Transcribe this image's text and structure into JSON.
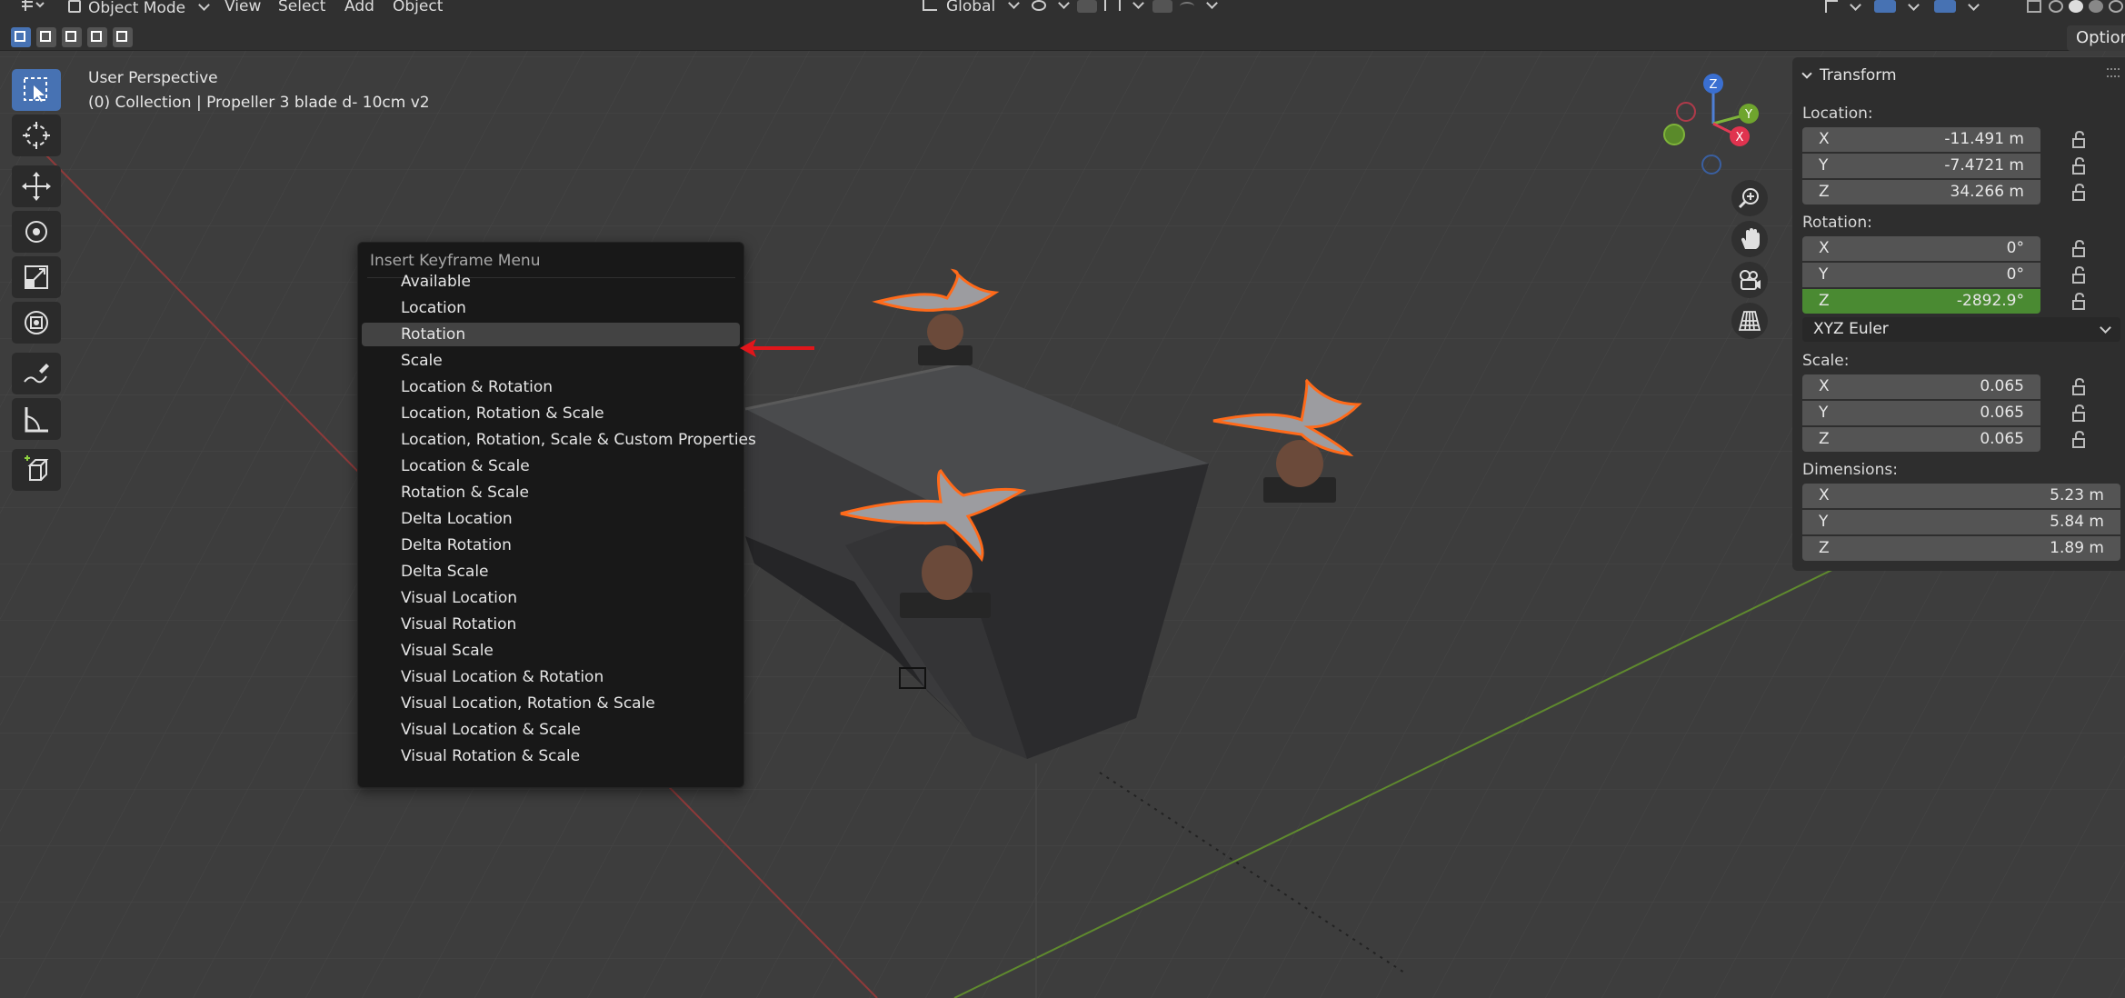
{
  "header": {
    "mode": "Object Mode",
    "menus": [
      "View",
      "Select",
      "Add",
      "Object"
    ],
    "transform_orientation": "Global"
  },
  "toolrow": {
    "options_label": "Options"
  },
  "viewport": {
    "perspective": "User Perspective",
    "collection": "(0) Collection | Propeller 3 blade d- 10cm v2"
  },
  "gizmo": {
    "x": "X",
    "y": "Y",
    "z": "Z"
  },
  "npanel": {
    "title": "Transform",
    "location_label": "Location:",
    "location": [
      {
        "axis": "X",
        "value": "-11.491 m"
      },
      {
        "axis": "Y",
        "value": "-7.4721 m"
      },
      {
        "axis": "Z",
        "value": "34.266 m"
      }
    ],
    "rotation_label": "Rotation:",
    "rotation": [
      {
        "axis": "X",
        "value": "0°"
      },
      {
        "axis": "Y",
        "value": "0°"
      },
      {
        "axis": "Z",
        "value": "-2892.9°"
      }
    ],
    "rotation_mode": "XYZ Euler",
    "scale_label": "Scale:",
    "scale": [
      {
        "axis": "X",
        "value": "0.065"
      },
      {
        "axis": "Y",
        "value": "0.065"
      },
      {
        "axis": "Z",
        "value": "0.065"
      }
    ],
    "dimensions_label": "Dimensions:",
    "dimensions": [
      {
        "axis": "X",
        "value": "5.23 m"
      },
      {
        "axis": "Y",
        "value": "5.84 m"
      },
      {
        "axis": "Z",
        "value": "1.89 m"
      }
    ]
  },
  "keyframe_menu": {
    "title": "Insert Keyframe Menu",
    "highlighted_index": 2,
    "items": [
      "Available",
      "Location",
      "Rotation",
      "Scale",
      "Location & Rotation",
      "Location, Rotation & Scale",
      "Location, Rotation, Scale & Custom Properties",
      "Location & Scale",
      "Rotation & Scale",
      "Delta Location",
      "Delta Rotation",
      "Delta Scale",
      "Visual Location",
      "Visual Rotation",
      "Visual Scale",
      "Visual Location & Rotation",
      "Visual Location, Rotation & Scale",
      "Visual Location & Scale",
      "Visual Rotation & Scale"
    ]
  },
  "colors": {
    "active_tool": "#4772b3",
    "animated_field": "#4a8a32",
    "annotation_arrow": "#e0161b",
    "propeller_outline": "#ff6a1a"
  }
}
